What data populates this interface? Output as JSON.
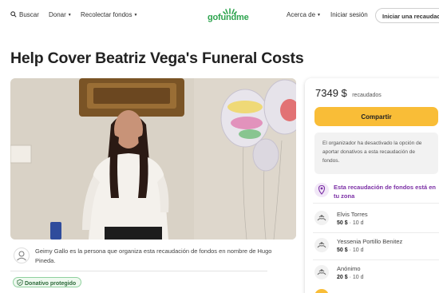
{
  "header": {
    "search_label": "Buscar",
    "donate_label": "Donar",
    "fundraise_label": "Recolectar fondos",
    "logo_text": "gofundme",
    "about_label": "Acerca de",
    "signin_label": "Iniciar sesión",
    "start_label": "Iniciar una recaudación"
  },
  "campaign": {
    "title": "Help Cover Beatriz Vega's Funeral Costs",
    "organizer_text": "Geimy Gallo es la persona que organiza esta recaudación de fondos en nombre de Hugo Pineda.",
    "protected_badge": "Donativo protegido"
  },
  "sidebar": {
    "raised_amount": "7349 $",
    "raised_label": "recaudados",
    "share_label": "Compartir",
    "notice_text": "El organizador ha desactivado la opción de aportar donativos a esta recaudación de fondos.",
    "trending_text": "Esta recaudación de fondos está en tu zona",
    "donations": [
      {
        "name": "Elvis Torres",
        "amount": "50 $",
        "time": "10 d"
      },
      {
        "name": "Yessenia Portillo Benitez",
        "amount": "50 $",
        "time": "10 d"
      },
      {
        "name": "Anónimo",
        "amount": "20 $",
        "time": "10 d"
      }
    ]
  },
  "colors": {
    "brand_green": "#2ea44f",
    "share_button": "#f9bd37",
    "trending_purple": "#7b2fa5"
  }
}
